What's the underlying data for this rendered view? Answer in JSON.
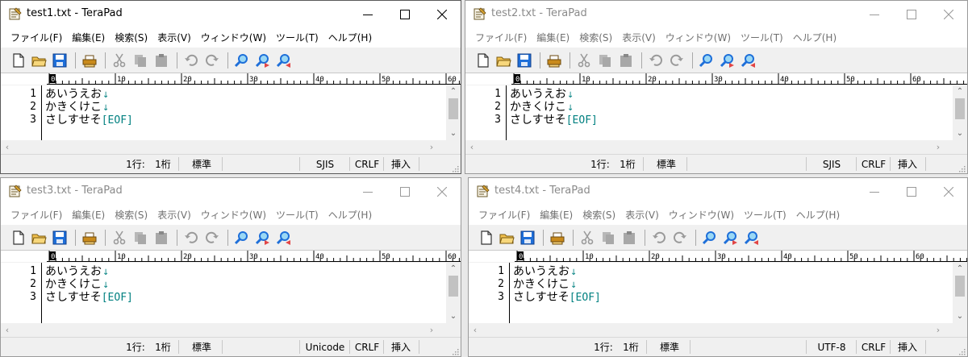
{
  "windows": [
    {
      "title": "test1.txt - TeraPad",
      "active": true,
      "status": {
        "line": "1行:",
        "col": "1桁",
        "mode": "標準",
        "encoding": "SJIS",
        "newline": "CRLF",
        "insert": "挿入"
      }
    },
    {
      "title": "test2.txt - TeraPad",
      "active": false,
      "status": {
        "line": "1行:",
        "col": "1桁",
        "mode": "標準",
        "encoding": "SJIS",
        "newline": "CRLF",
        "insert": "挿入"
      }
    },
    {
      "title": "test3.txt - TeraPad",
      "active": false,
      "status": {
        "line": "1行:",
        "col": "1桁",
        "mode": "標準",
        "encoding": "Unicode",
        "newline": "CRLF",
        "insert": "挿入"
      }
    },
    {
      "title": "test4.txt - TeraPad",
      "active": false,
      "status": {
        "line": "1行:",
        "col": "1桁",
        "mode": "標準",
        "encoding": "UTF-8",
        "newline": "CRLF",
        "insert": "挿入"
      }
    }
  ],
  "menu": [
    "ファイル(F)",
    "編集(E)",
    "検索(S)",
    "表示(V)",
    "ウィンドウ(W)",
    "ツール(T)",
    "ヘルプ(H)"
  ],
  "document": {
    "lines": [
      {
        "number": "1",
        "text": "あいうえお",
        "end": "↓"
      },
      {
        "number": "2",
        "text": "かきくけこ",
        "end": "↓"
      },
      {
        "number": "3",
        "text": "さしすせそ",
        "end": "[EOF]"
      }
    ]
  },
  "ruler": {
    "labels": [
      "0",
      "10",
      "20",
      "30",
      "40",
      "50",
      "60"
    ]
  },
  "toolbar_icons": [
    "new-file-icon",
    "open-folder-icon",
    "save-icon",
    "print-icon",
    "cut-icon",
    "copy-icon",
    "paste-icon",
    "undo-icon",
    "redo-icon",
    "search-icon",
    "search-next-icon",
    "search-prev-icon"
  ],
  "colors": {
    "line_end": "#008080",
    "toolbar_blue": "#1e6fd9"
  }
}
